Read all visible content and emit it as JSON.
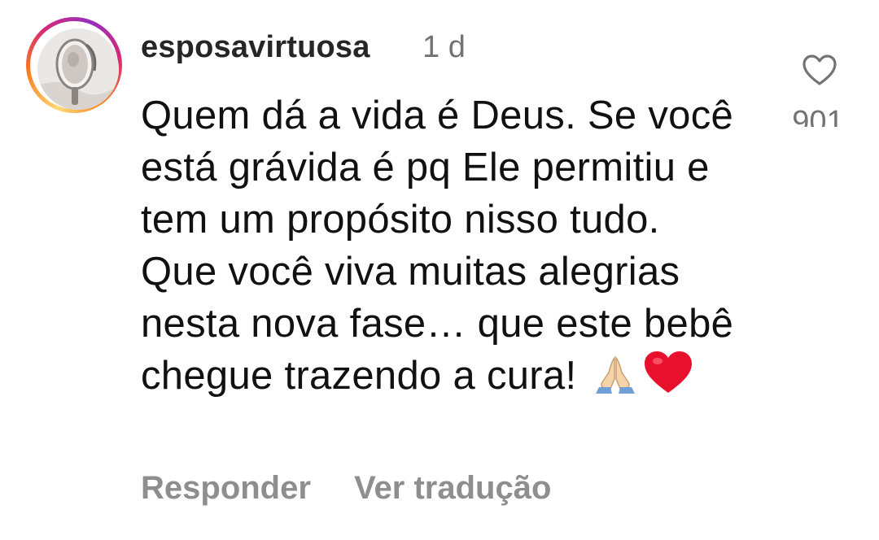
{
  "comment": {
    "username": "esposavirtuosa",
    "time": "1 d",
    "text": "Quem dá a vida é Deus. Se você está grávida é pq Ele permitiu e tem um propósito nisso tudo. Que você viva muitas alegrias nesta nova fase… que este bebê chegue trazendo a cura!",
    "emojis": [
      "praying-hands-emoji",
      "red-heart-emoji"
    ],
    "like_icon": "heart-outline-icon",
    "like_count": "901",
    "actions": {
      "reply": "Responder",
      "translate": "Ver tradução"
    }
  }
}
